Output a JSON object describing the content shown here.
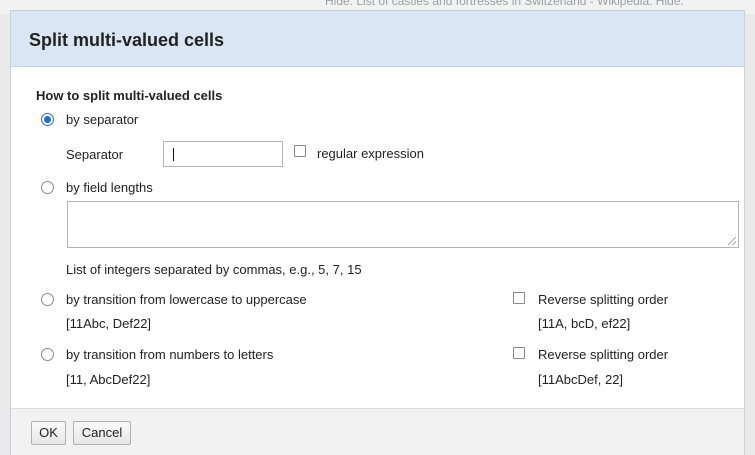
{
  "background": {
    "window_text": "Hide: List of castles and fortresses in Switzerland - Wikipedia: Hide:"
  },
  "dialog": {
    "title": "Split multi-valued cells",
    "section_title": "How to split multi-valued cells",
    "options": {
      "separator": {
        "label": "by separator",
        "selected": true
      },
      "field_lengths": {
        "label": "by field lengths",
        "selected": false
      },
      "lower_upper": {
        "label": "by transition from lowercase to uppercase",
        "example": "[11Abc, Def22]",
        "selected": false
      },
      "numbers_letters": {
        "label": "by transition from numbers to letters",
        "example": "[11, AbcDef22]",
        "selected": false
      }
    },
    "separator_label": "Separator",
    "separator_value": "",
    "regex_label": "regular expression",
    "field_lengths_value": "",
    "field_lengths_help": "List of integers separated by commas, e.g., 5, 7, 15",
    "reverse_lower_upper": {
      "label": "Reverse splitting order",
      "example": "[11A, bcD, ef22]",
      "checked": false
    },
    "reverse_numbers_letters": {
      "label": "Reverse splitting order",
      "example": "[11AbcDef, 22]",
      "checked": false
    },
    "buttons": {
      "ok": "OK",
      "cancel": "Cancel"
    }
  },
  "colors": {
    "header_bg": "#dbe6f5",
    "radio_selected": "#1f6fd6",
    "footer_bg": "#f2f2f2"
  }
}
